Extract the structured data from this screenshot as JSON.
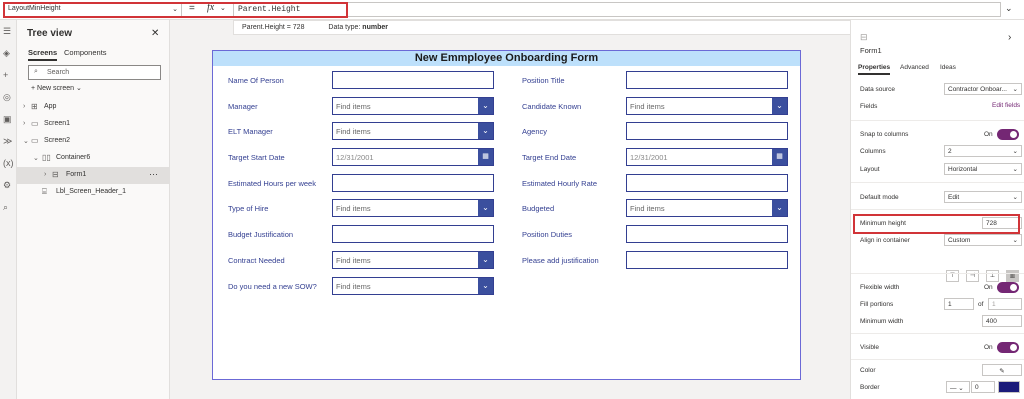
{
  "formula_bar": {
    "property": "LayoutMinHeight",
    "equals": "=",
    "fx": "fx",
    "formula": "Parent.Height",
    "hint_left": "Parent.Height  =  728",
    "hint_type_label": "Data type:",
    "hint_type_value": "number"
  },
  "tree_view": {
    "title": "Tree view",
    "tabs": [
      "Screens",
      "Components"
    ],
    "search_placeholder": "Search",
    "new_screen": "New screen",
    "items": [
      {
        "label": "App"
      },
      {
        "label": "Screen1"
      },
      {
        "label": "Screen2"
      },
      {
        "label": "Container6"
      },
      {
        "label": "Form1"
      },
      {
        "label": "Lbl_Screen_Header_1"
      }
    ],
    "more": "···"
  },
  "form": {
    "header": "New Emmployee Onboarding Form",
    "left_fields": [
      {
        "label": "Name Of Person",
        "value": ""
      },
      {
        "label": "Manager",
        "value": "Find items"
      },
      {
        "label": "ELT Manager",
        "value": "Find items"
      },
      {
        "label": "Target Start Date",
        "value": "12/31/2001"
      },
      {
        "label": "Estimated Hours per week",
        "value": ""
      },
      {
        "label": "Type of Hire",
        "value": "Find items"
      },
      {
        "label": "Budget Justification",
        "value": ""
      },
      {
        "label": "Contract Needed",
        "value": "Find items"
      },
      {
        "label": "Do you need a new SOW?",
        "value": "Find items"
      }
    ],
    "right_fields": [
      {
        "label": "Position Title",
        "value": ""
      },
      {
        "label": "Candidate Known",
        "value": "Find items"
      },
      {
        "label": "Agency",
        "value": ""
      },
      {
        "label": "Target End Date",
        "value": "12/31/2001"
      },
      {
        "label": "Estimated Hourly Rate",
        "value": ""
      },
      {
        "label": "Budgeted",
        "value": "Find items"
      },
      {
        "label": "Position Duties",
        "value": ""
      },
      {
        "label": "Please add justification",
        "value": ""
      }
    ]
  },
  "properties_panel": {
    "name": "Form1",
    "tabs": [
      "Properties",
      "Advanced",
      "Ideas"
    ],
    "data_source_label": "Data source",
    "data_source_value": "Contractor Onboar...",
    "fields_label": "Fields",
    "edit_fields": "Edit fields",
    "snap_label": "Snap to columns",
    "snap_value": "On",
    "columns_label": "Columns",
    "columns_value": "2",
    "layout_label": "Layout",
    "layout_value": "Horizontal",
    "default_mode_label": "Default mode",
    "default_mode_value": "Edit",
    "min_height_label": "Minimum height",
    "min_height_value": "728",
    "align_label": "Align in container",
    "align_value": "Custom",
    "flexible_width_label": "Flexible width",
    "flexible_width_value": "On",
    "fill_portions_label": "Fill portions",
    "fill_portions_value": "1",
    "fill_of": "of",
    "fill_of_value": "1",
    "min_width_label": "Minimum width",
    "min_width_value": "400",
    "visible_label": "Visible",
    "visible_value": "On",
    "color_label": "Color",
    "border_label": "Border",
    "border_width": "0",
    "border_color": "#1b1b7a"
  }
}
